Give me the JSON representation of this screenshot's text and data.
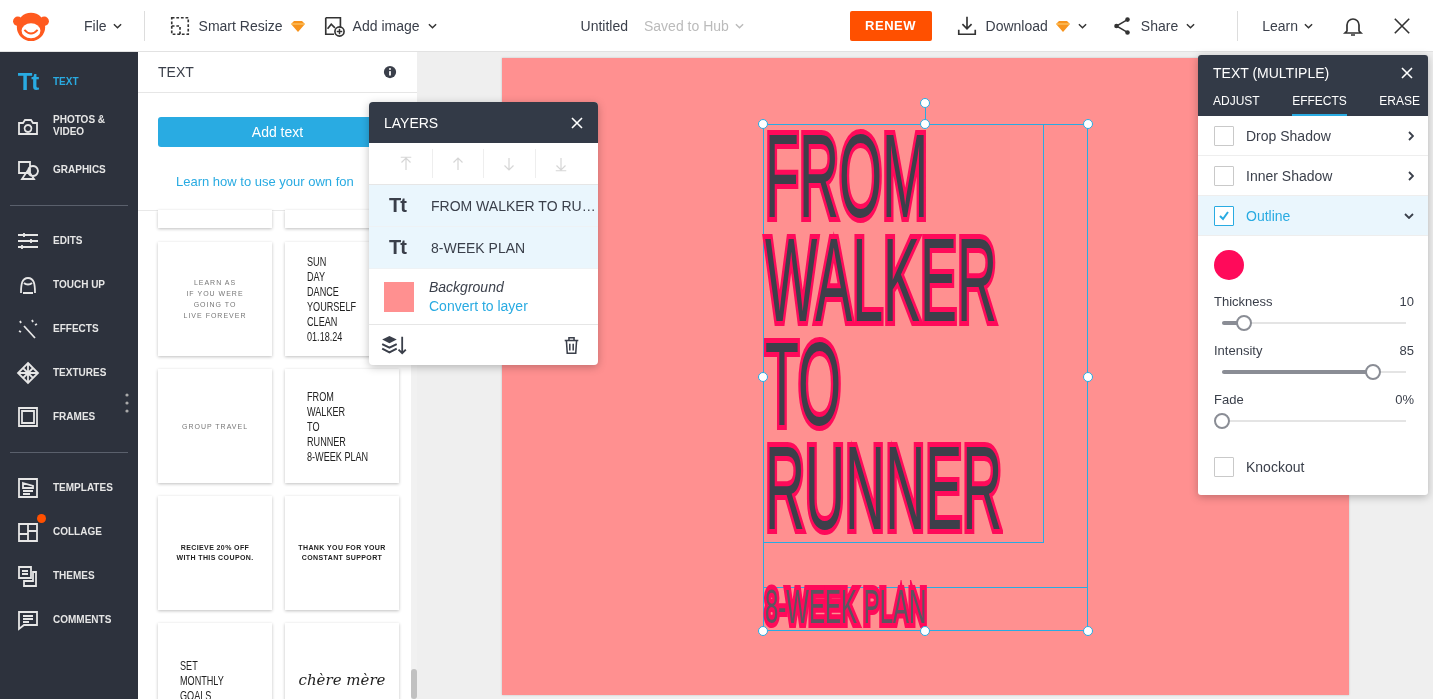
{
  "topbar": {
    "file_menu": "File",
    "tools": [
      {
        "label": "Smart Resize",
        "premium": true,
        "dropdown": false
      },
      {
        "label": "Add image",
        "premium": false,
        "dropdown": true
      }
    ],
    "title": "Untitled",
    "save_status": "Saved to Hub",
    "renew": "RENEW",
    "actions": [
      {
        "label": "Download",
        "premium": true
      },
      {
        "label": "Share",
        "premium": false
      }
    ],
    "learn": "Learn"
  },
  "nav": {
    "groups": [
      [
        {
          "label": "TEXT",
          "glyph": "Tt",
          "selected": true,
          "badge": false
        },
        {
          "label": "PHOTOS & VIDEO",
          "selected": false,
          "badge": false
        },
        {
          "label": "GRAPHICS",
          "selected": false,
          "badge": false
        }
      ],
      [
        {
          "label": "EDITS",
          "selected": false,
          "badge": false
        },
        {
          "label": "TOUCH UP",
          "selected": false,
          "badge": false
        },
        {
          "label": "EFFECTS",
          "selected": false,
          "badge": false
        },
        {
          "label": "TEXTURES",
          "selected": false,
          "badge": false
        },
        {
          "label": "FRAMES",
          "selected": false,
          "badge": false
        }
      ],
      [
        {
          "label": "TEMPLATES",
          "selected": false,
          "badge": false
        },
        {
          "label": "COLLAGE",
          "selected": false,
          "badge": true
        },
        {
          "label": "THEMES",
          "selected": false,
          "badge": false
        },
        {
          "label": "COMMENTS",
          "selected": false,
          "badge": false
        }
      ]
    ]
  },
  "text_panel": {
    "title": "TEXT",
    "add_button": "Add text",
    "link": "Learn how to use your own fon",
    "templates": [
      {
        "lines": [
          "LEARN AS",
          "IF YOU WERE",
          "GOING TO",
          "LIVE FOREVER"
        ]
      },
      {
        "lines": [
          "SUN",
          "DAY",
          "DANCE",
          "YOURSELF",
          "CLEAN",
          "01.18.24"
        ]
      },
      {
        "lines": [
          "GROUP TRAVEL"
        ]
      },
      {
        "lines": [
          "FROM",
          "WALKER",
          "TO",
          "RUNNER",
          "8-WEEK PLAN"
        ]
      },
      {
        "lines": [
          "RECIEVE 20% OFF",
          "WITH THIS COUPON."
        ]
      },
      {
        "lines": [
          "THANK YOU FOR YOUR",
          "CONSTANT SUPPORT"
        ]
      },
      {
        "lines": [
          "SET",
          "MONTHLY",
          "GOALS"
        ]
      },
      {
        "lines": [
          "chère mère"
        ]
      }
    ]
  },
  "layers": {
    "title": "LAYERS",
    "arrange_disabled": true,
    "items": [
      {
        "kind": "text",
        "glyph": "Tt",
        "label": "FROM WALKER TO RU…",
        "selected": true
      },
      {
        "kind": "text",
        "glyph": "Tt",
        "label": "8-WEEK PLAN",
        "selected": true
      },
      {
        "kind": "background",
        "label": "Background",
        "link": "Convert to layer",
        "color": "#ff9090",
        "selected": false
      }
    ]
  },
  "canvas": {
    "headline": "FROM WALKER TO RUNNER",
    "subtitle": "8-WEEK PLAN"
  },
  "effects_panel": {
    "title": "TEXT (MULTIPLE)",
    "tabs": [
      {
        "label": "ADJUST",
        "selected": false
      },
      {
        "label": "EFFECTS",
        "selected": true
      },
      {
        "label": "ERASE",
        "selected": false
      }
    ],
    "effects": [
      {
        "label": "Drop Shadow",
        "checked": false,
        "expanded": false
      },
      {
        "label": "Inner Shadow",
        "checked": false,
        "expanded": false
      },
      {
        "label": "Outline",
        "checked": true,
        "expanded": true,
        "color": "#ff0a5a",
        "sliders": [
          {
            "label": "Thickness",
            "reading": "10",
            "level": 0.12
          },
          {
            "label": "Intensity",
            "reading": "85",
            "level": 0.82
          },
          {
            "label": "Fade",
            "reading": "0%",
            "level": 0
          }
        ]
      }
    ],
    "knockout": {
      "label": "Knockout",
      "checked": false
    }
  }
}
